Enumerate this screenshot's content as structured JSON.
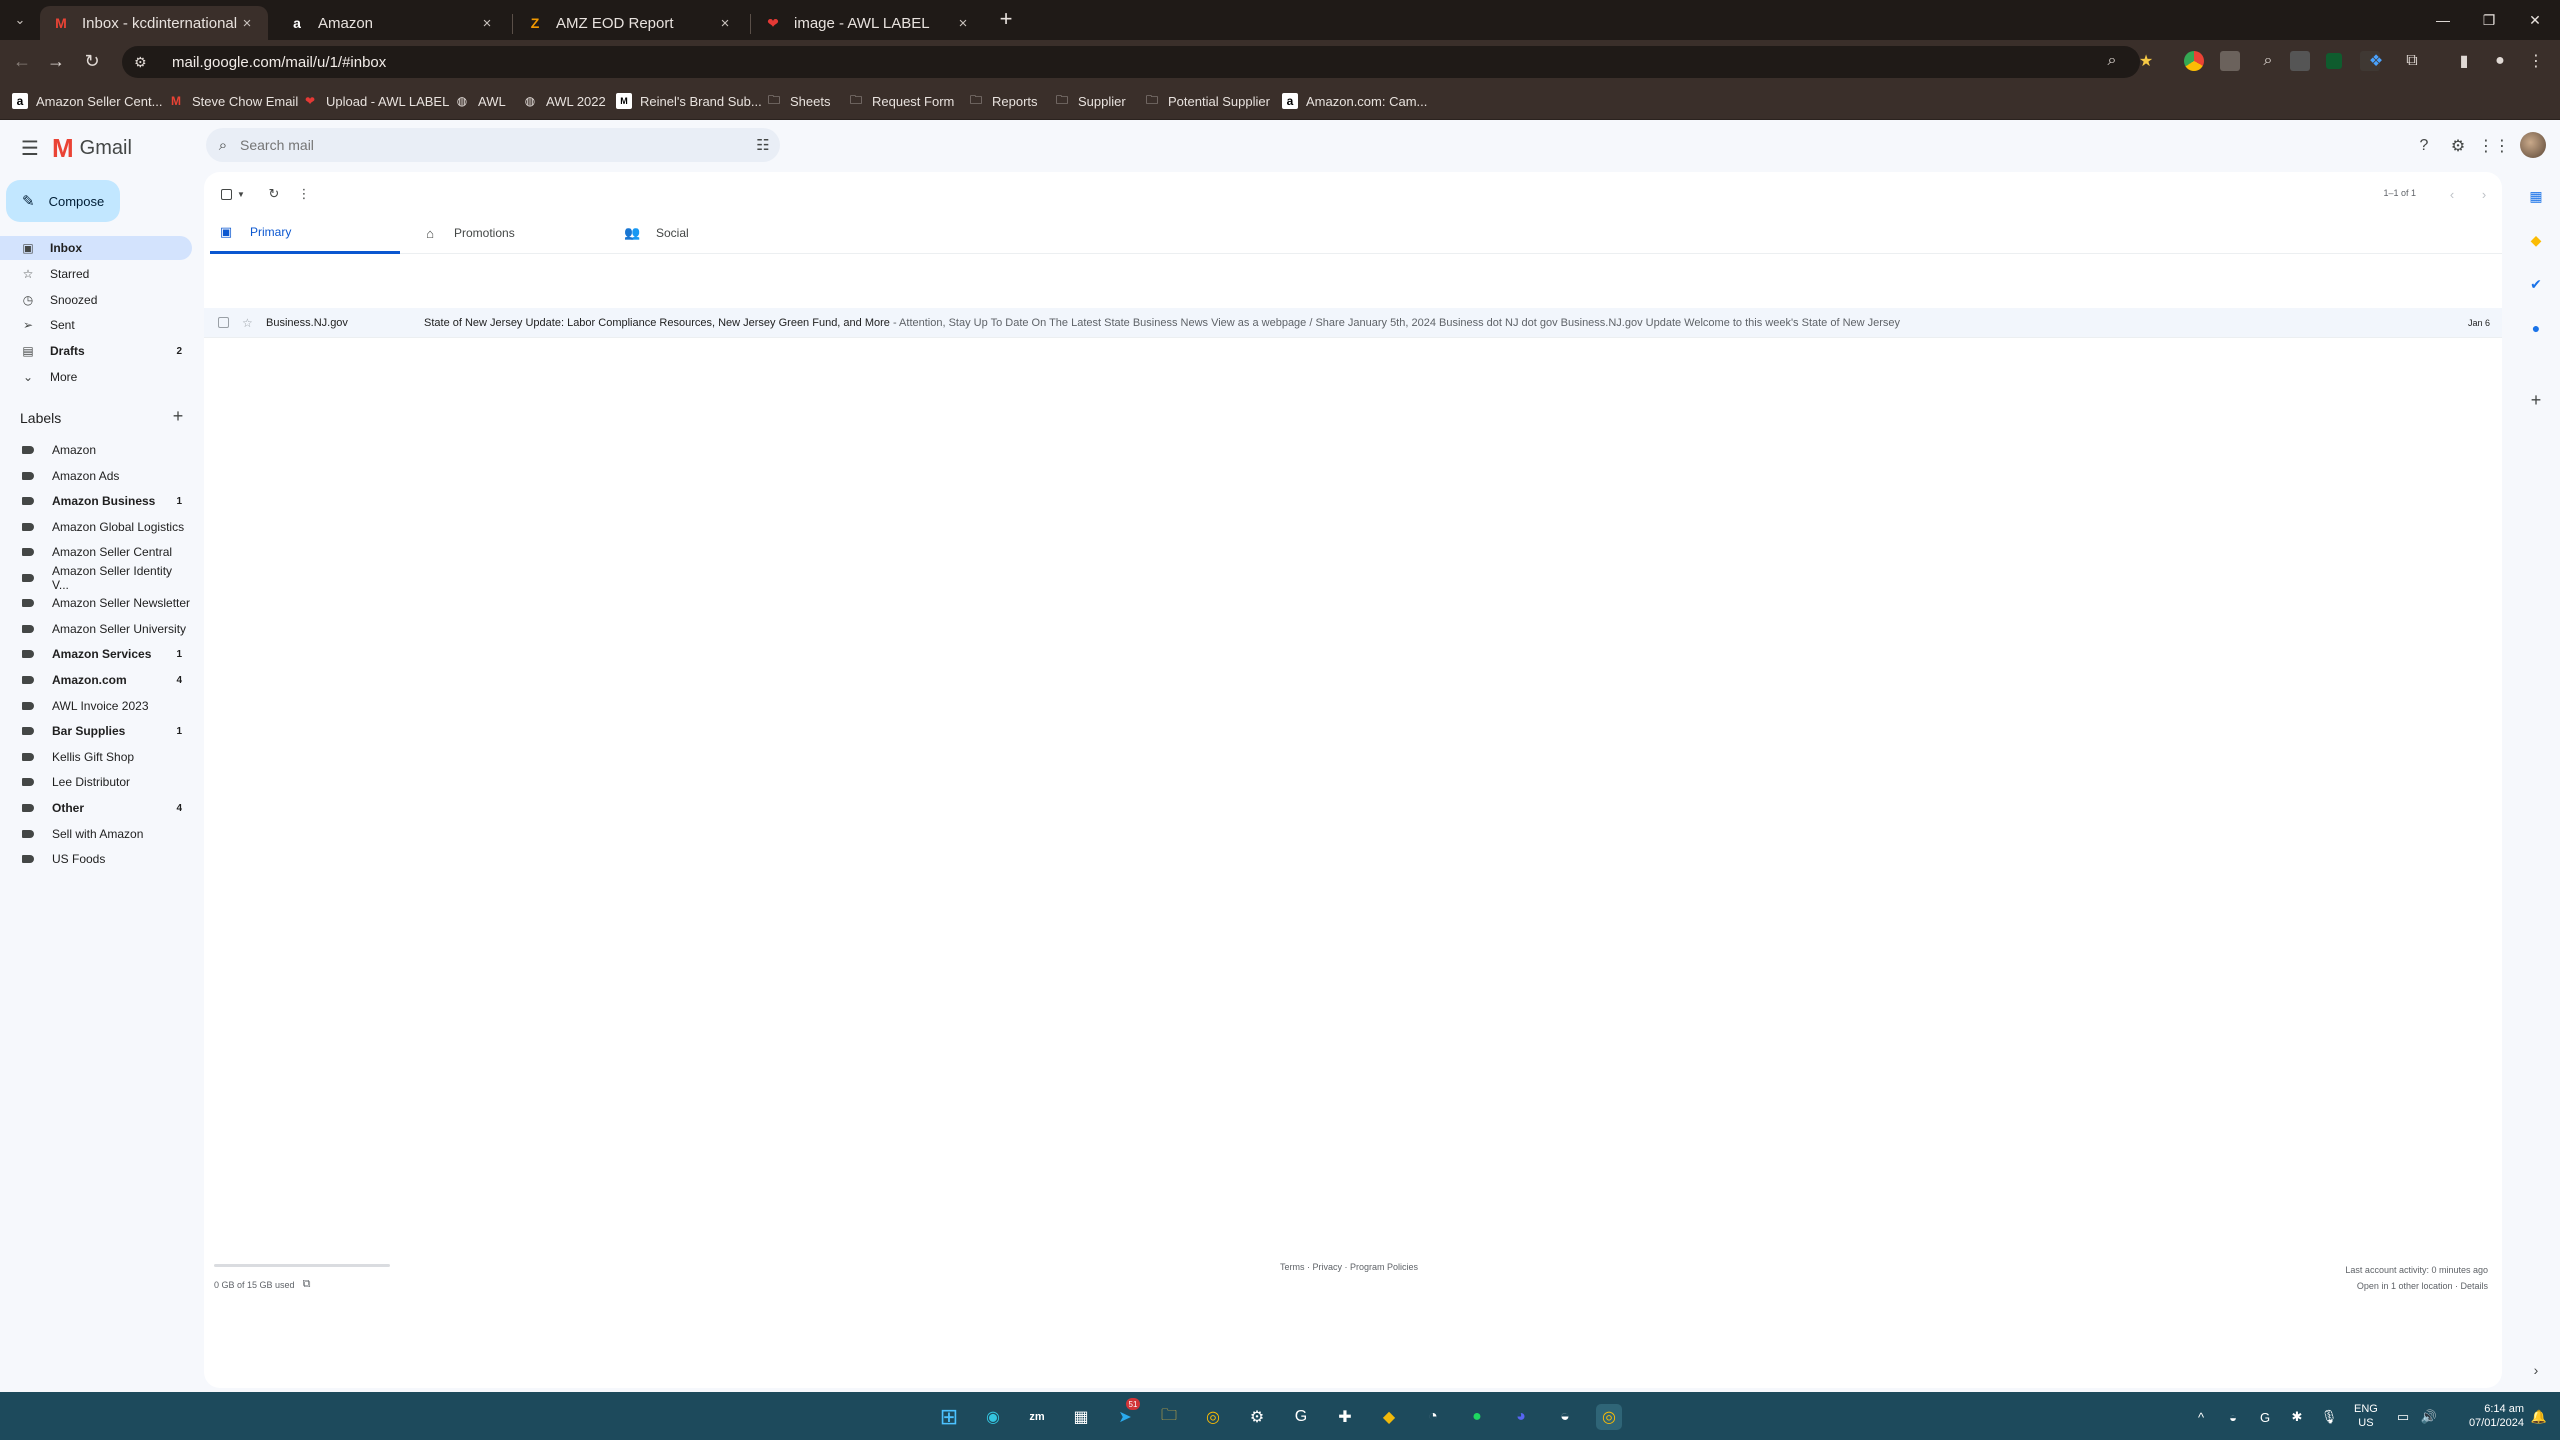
{
  "browser": {
    "tabs": [
      {
        "title": "Inbox - kcdinternationalllc@gm",
        "close": "×"
      },
      {
        "title": "Amazon",
        "close": "×"
      },
      {
        "title": "AMZ EOD Report",
        "close": "×"
      },
      {
        "title": "image - AWL LABEL",
        "close": "×"
      }
    ],
    "url": "mail.google.com/mail/u/1/#inbox",
    "bookmarks": [
      "Amazon Seller Cent...",
      "Steve Chow Email",
      "Upload - AWL LABEL",
      "AWL",
      "AWL 2022",
      "Reinel's Brand Sub...",
      "Sheets",
      "Request Form",
      "Reports",
      "Supplier",
      "Potential Supplier",
      "Amazon.com: Cam..."
    ]
  },
  "gmail": {
    "logo_text": "Gmail",
    "search_placeholder": "Search mail",
    "compose_label": "Compose",
    "nav": [
      {
        "label": "Inbox",
        "count": ""
      },
      {
        "label": "Starred",
        "count": ""
      },
      {
        "label": "Snoozed",
        "count": ""
      },
      {
        "label": "Sent",
        "count": ""
      },
      {
        "label": "Drafts",
        "count": "2"
      },
      {
        "label": "More",
        "count": ""
      }
    ],
    "labels_title": "Labels",
    "labels": [
      {
        "name": "Amazon",
        "count": ""
      },
      {
        "name": "Amazon Ads",
        "count": ""
      },
      {
        "name": "Amazon Business",
        "count": "1"
      },
      {
        "name": "Amazon Global Logistics",
        "count": ""
      },
      {
        "name": "Amazon Seller Central",
        "count": ""
      },
      {
        "name": "Amazon Seller Identity V...",
        "count": ""
      },
      {
        "name": "Amazon Seller Newsletter",
        "count": ""
      },
      {
        "name": "Amazon Seller University",
        "count": ""
      },
      {
        "name": "Amazon Services",
        "count": "1"
      },
      {
        "name": "Amazon.com",
        "count": "4"
      },
      {
        "name": "AWL Invoice 2023",
        "count": ""
      },
      {
        "name": "Bar Supplies",
        "count": "1"
      },
      {
        "name": "Kellis Gift Shop",
        "count": ""
      },
      {
        "name": "Lee Distributor",
        "count": ""
      },
      {
        "name": "Other",
        "count": "4"
      },
      {
        "name": "Sell with Amazon",
        "count": ""
      },
      {
        "name": "US Foods",
        "count": ""
      }
    ],
    "pager": "1–1 of 1",
    "category_tabs": [
      "Primary",
      "Promotions",
      "Social"
    ],
    "emails": [
      {
        "sender": "Business.NJ.gov",
        "subject": "State of New Jersey Update: Labor Compliance Resources, New Jersey Green Fund, and More",
        "snippet": " - Attention, Stay Up To Date On The Latest State Business News View as a webpage / Share January 5th, 2024 Business dot NJ dot gov Business.NJ.gov Update Welcome to this week's State of New Jersey",
        "date": "Jan 6"
      }
    ],
    "storage_text": "0 GB of 15 GB used",
    "storage_fraction": 0.0,
    "footer_links": "Terms · Privacy · Program Policies",
    "last_activity": "Last account activity: 0 minutes ago",
    "other_location": "Open in 1 other location · Details"
  },
  "taskbar": {
    "telegram_badge": "51",
    "lang_line1": "ENG",
    "lang_line2": "US",
    "time": "6:14 am",
    "date": "07/01/2024"
  }
}
